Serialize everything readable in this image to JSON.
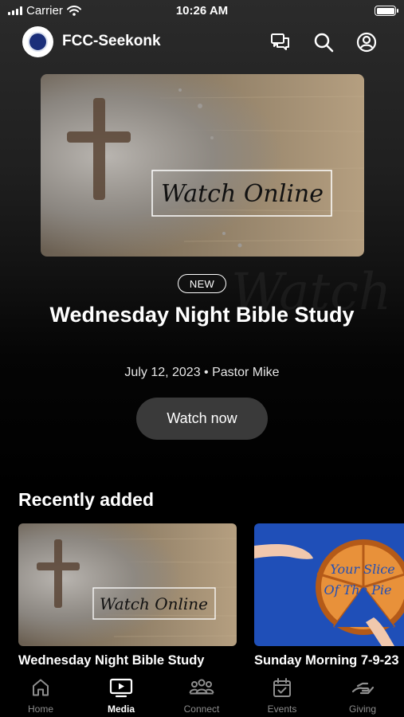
{
  "status_bar": {
    "carrier": "Carrier",
    "time": "10:26 AM"
  },
  "header": {
    "title": "FCC-Seekonk",
    "icons": [
      "chat-icon",
      "search-icon",
      "profile-icon"
    ]
  },
  "featured": {
    "image_text": "Watch Online",
    "badge": "NEW",
    "title": "Wednesday Night Bible Study",
    "meta": "July 12, 2023 • Pastor Mike",
    "button_label": "Watch now"
  },
  "recent": {
    "heading": "Recently added",
    "items": [
      {
        "title": "Wednesday Night Bible Study",
        "image_text": "Watch Online"
      },
      {
        "title": "Sunday Morning 7-9-23",
        "image_text_line1": "Your Slice",
        "image_text_line2": "Of The Pie"
      }
    ]
  },
  "tabs": [
    {
      "label": "Home",
      "icon": "home-icon"
    },
    {
      "label": "Media",
      "icon": "media-icon",
      "active": true
    },
    {
      "label": "Connect",
      "icon": "people-icon"
    },
    {
      "label": "Events",
      "icon": "calendar-icon"
    },
    {
      "label": "Giving",
      "icon": "giving-icon"
    }
  ],
  "colors": {
    "background": "#000000",
    "button": "#3a3a3a",
    "inactive_tab": "#8e8e8e",
    "pie_bg": "#1f4fb8"
  }
}
